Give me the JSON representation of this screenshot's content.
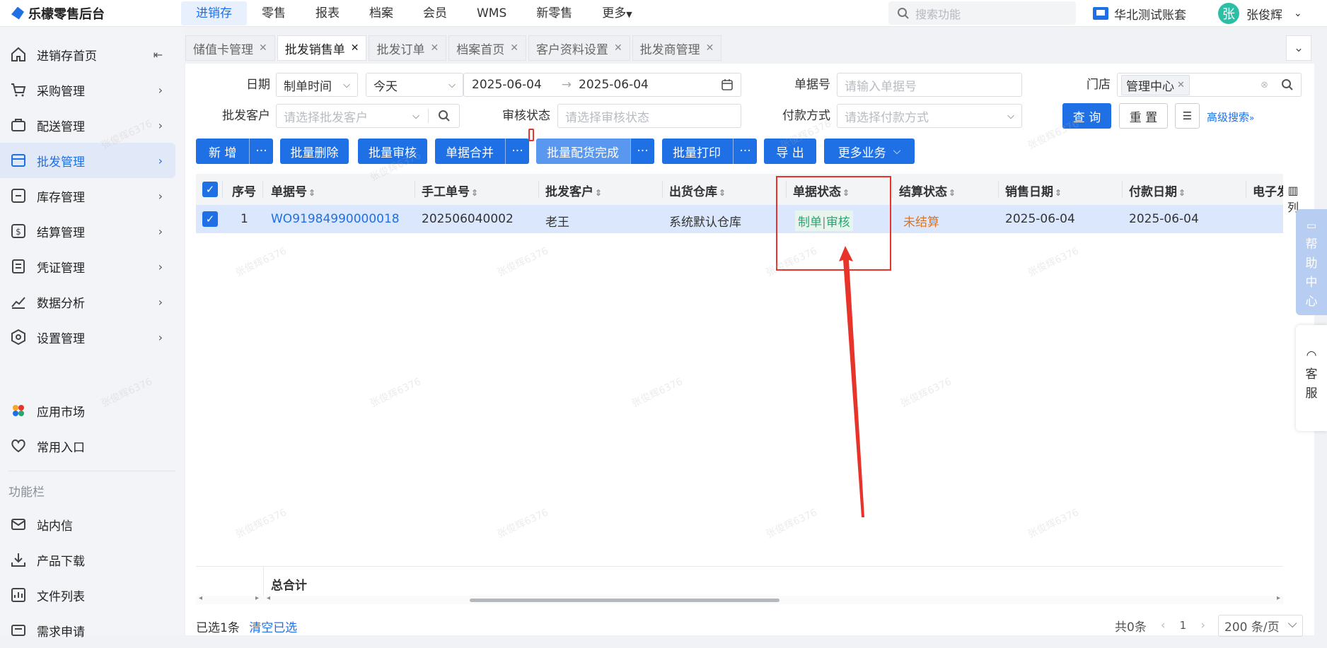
{
  "brand": {
    "name": "乐檬零售后台"
  },
  "topnav": [
    "进销存",
    "零售",
    "报表",
    "档案",
    "会员",
    "WMS",
    "新零售",
    "更多"
  ],
  "search": {
    "placeholder": "搜索功能"
  },
  "account": {
    "name": "华北测试账套"
  },
  "user": {
    "avatar": "张",
    "name": "张俊辉"
  },
  "sidebar": {
    "items": [
      {
        "label": "进销存首页",
        "icon": "home-icon"
      },
      {
        "label": "采购管理",
        "icon": "cart-icon"
      },
      {
        "label": "配送管理",
        "icon": "delivery-icon"
      },
      {
        "label": "批发管理",
        "icon": "wholesale-icon"
      },
      {
        "label": "库存管理",
        "icon": "stock-icon"
      },
      {
        "label": "结算管理",
        "icon": "settle-icon"
      },
      {
        "label": "凭证管理",
        "icon": "voucher-icon"
      },
      {
        "label": "数据分析",
        "icon": "chart-icon"
      },
      {
        "label": "设置管理",
        "icon": "settings-icon"
      }
    ],
    "extra": [
      {
        "label": "应用市场",
        "icon": "app-market-icon"
      },
      {
        "label": "常用入口",
        "icon": "heart-icon"
      }
    ],
    "caption": "功能栏",
    "tools": [
      {
        "label": "站内信",
        "icon": "mail-icon"
      },
      {
        "label": "产品下载",
        "icon": "download-icon"
      },
      {
        "label": "文件列表",
        "icon": "file-list-icon"
      },
      {
        "label": "需求申请",
        "icon": "request-icon"
      }
    ]
  },
  "tabs": [
    "储值卡管理",
    "批发销售单",
    "批发订单",
    "档案首页",
    "客户资料设置",
    "批发商管理"
  ],
  "filters": {
    "date_label": "日期",
    "date_type": "制单时间",
    "date_range": "今天",
    "start": "2025-06-04",
    "arrow": "→",
    "end": "2025-06-04",
    "doc_no_label": "单据号",
    "doc_no_placeholder": "请输入单据号",
    "store_label": "门店",
    "store_tag": "管理中心",
    "customer_label": "批发客户",
    "customer_placeholder": "请选择批发客户",
    "audit_label": "审核状态",
    "audit_placeholder": "请选择审核状态",
    "pay_label": "付款方式",
    "pay_placeholder": "请选择付款方式",
    "query": "查 询",
    "reset": "重 置",
    "advanced": "高级搜索"
  },
  "actions": {
    "add": "新 增",
    "batch_delete": "批量删除",
    "batch_audit": "批量审核",
    "merge": "单据合并",
    "batch_dist": "批量配货完成",
    "batch_print": "批量打印",
    "export": "导 出",
    "more": "更多业务",
    "dots": "···"
  },
  "table": {
    "headers": [
      "序号",
      "单据号",
      "手工单号",
      "批发客户",
      "出货仓库",
      "单据状态",
      "结算状态",
      "销售日期",
      "付款日期",
      "电子发"
    ],
    "rows": [
      {
        "idx": "1",
        "doc_no": "WO91984990000018",
        "manual_no": "202506040002",
        "customer": "老王",
        "warehouse": "系统默认仓库",
        "status_a": "制单",
        "status_sep": "|",
        "status_b": "审核",
        "settle": "未结算",
        "sale_date": "2025-06-04",
        "pay_date": "2025-06-04"
      }
    ],
    "total_label": "总合计",
    "column_config": "列"
  },
  "footer": {
    "selected": "已选1条",
    "clear": "清空已选",
    "total": "共0条",
    "page": "1",
    "page_size": "200 条/页"
  },
  "help": {
    "label": [
      "帮",
      "助",
      "中",
      "心"
    ]
  },
  "kefu": {
    "label": [
      "客",
      "服"
    ]
  },
  "watermark": "张俊辉6376",
  "colors": {
    "primary": "#1f6fe5",
    "status_green": "#2ba471",
    "warning": "#e37318",
    "annotation": "#e8332b"
  }
}
